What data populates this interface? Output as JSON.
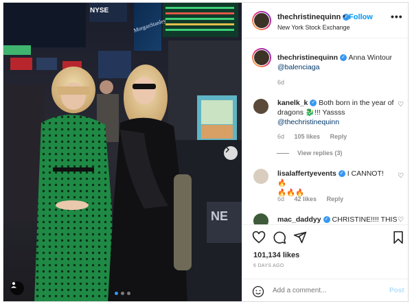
{
  "header": {
    "username": "thechristinequinn",
    "follow_label": "Follow",
    "separator": "•",
    "location": "New York Stock Exchange",
    "more_label": "•••"
  },
  "caption": {
    "username": "thechristinequinn",
    "text": "Anna Wintour",
    "mention": "@balenciaga",
    "time": "6d"
  },
  "comments": [
    {
      "username": "kanelk_k",
      "text_line1": "Both born in the year of",
      "text_line2": "dragons 🐉!!! Yassss",
      "mention": "@thechristinequinn",
      "time": "6d",
      "likes": "105 likes",
      "reply_label": "Reply",
      "view_replies": "View replies (3)"
    },
    {
      "username": "lisalaffertyevents",
      "text_line1": "I CANNOT! 🔥",
      "text_line2": "🔥🔥🔥",
      "time": "6d",
      "likes": "42 likes",
      "reply_label": "Reply"
    },
    {
      "username": "mac_daddyy",
      "text_line1": "CHRISTINE!!!! THIS"
    }
  ],
  "actions": {
    "likes_count": "101,134 likes",
    "posted_ago": "6 DAYS AGO"
  },
  "add_comment": {
    "placeholder": "Add a comment...",
    "post_label": "Post"
  },
  "photo": {
    "signs": [
      "NYSE",
      "MorganStanley",
      "NE"
    ],
    "carousel_total": 3,
    "carousel_active": 1
  },
  "colors": {
    "link_blue": "#0095f6",
    "mention_blue": "#00376b",
    "muted_gray": "#8e8e8e",
    "dress_green": "#1f8a45"
  }
}
